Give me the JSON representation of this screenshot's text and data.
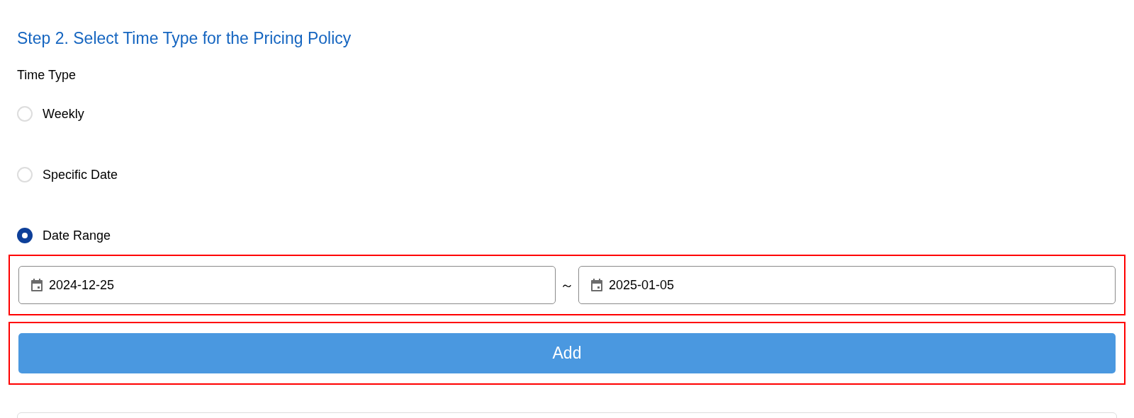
{
  "heading": "Step 2. Select Time Type for the Pricing Policy",
  "time_type": {
    "label": "Time Type",
    "options": [
      {
        "label": "Weekly",
        "selected": false
      },
      {
        "label": "Specific Date",
        "selected": false
      },
      {
        "label": "Date Range",
        "selected": true
      }
    ]
  },
  "date_range": {
    "highlighted": true,
    "start": "2024-12-25",
    "separator": "～",
    "end": "2025-01-05"
  },
  "add_button": {
    "label": "Add",
    "highlighted": true
  }
}
